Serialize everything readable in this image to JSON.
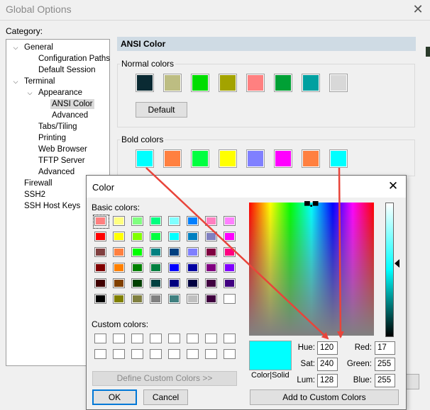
{
  "global_options": {
    "title": "Global Options",
    "category_label": "Category:",
    "tree": [
      {
        "label": "General",
        "expanded": true
      },
      {
        "label": "Configuration Paths"
      },
      {
        "label": "Default Session"
      },
      {
        "label": "Terminal",
        "expanded": true
      },
      {
        "label": "Appearance",
        "expanded": true
      },
      {
        "label": "ANSI Color",
        "selected": true
      },
      {
        "label": "Advanced"
      },
      {
        "label": "Tabs/Tiling"
      },
      {
        "label": "Printing"
      },
      {
        "label": "Web Browser"
      },
      {
        "label": "TFTP Server"
      },
      {
        "label": "Advanced"
      },
      {
        "label": "Firewall"
      },
      {
        "label": "SSH2"
      },
      {
        "label": "SSH Host Keys"
      }
    ],
    "page_title": "ANSI Color",
    "normal_colors_label": "Normal colors",
    "normal_colors": [
      "#0a2a33",
      "#bdbd82",
      "#00dd00",
      "#a3a300",
      "#ff8080",
      "#00a035",
      "#00a0a0",
      "#d8d8d8"
    ],
    "default_button": "Default",
    "bold_colors_label": "Bold colors",
    "bold_colors": [
      "#00ffff",
      "#ff8040",
      "#00ff40",
      "#ffff00",
      "#8080ff",
      "#ff00ff",
      "#ff8040",
      "#00ffff"
    ]
  },
  "color_dialog": {
    "title": "Color",
    "basic_colors_label": "Basic colors:",
    "basic_colors": [
      [
        "#ff8080",
        "#ffff80",
        "#80ff80",
        "#00ff80",
        "#80ffff",
        "#0080ff",
        "#ff80c0",
        "#ff80ff"
      ],
      [
        "#ff0000",
        "#ffff00",
        "#80ff00",
        "#00ff40",
        "#00ffff",
        "#0080c0",
        "#8080c0",
        "#ff00ff"
      ],
      [
        "#804040",
        "#ff8040",
        "#00ff00",
        "#008080",
        "#004080",
        "#8080ff",
        "#800040",
        "#ff0080"
      ],
      [
        "#800000",
        "#ff8000",
        "#008000",
        "#008040",
        "#0000ff",
        "#0000a0",
        "#800080",
        "#8000ff"
      ],
      [
        "#400000",
        "#804000",
        "#004000",
        "#004040",
        "#000080",
        "#000040",
        "#400040",
        "#400080"
      ],
      [
        "#000000",
        "#808000",
        "#808040",
        "#808080",
        "#408080",
        "#c0c0c0",
        "#400040",
        "#ffffff"
      ]
    ],
    "custom_colors_label": "Custom colors:",
    "define_custom_button": "Define Custom Colors >>",
    "ok_button": "OK",
    "cancel_button": "Cancel",
    "color_solid_label": "Color|Solid",
    "hue_label": "Hue:",
    "sat_label": "Sat:",
    "lum_label": "Lum:",
    "hue": "120",
    "sat": "240",
    "lum": "128",
    "red_label": "Red:",
    "green_label": "Green:",
    "blue_label": "Blue:",
    "red": "17",
    "green": "255",
    "blue": "255",
    "add_custom_button": "Add to Custom Colors",
    "selected_color": "#00ffff"
  }
}
